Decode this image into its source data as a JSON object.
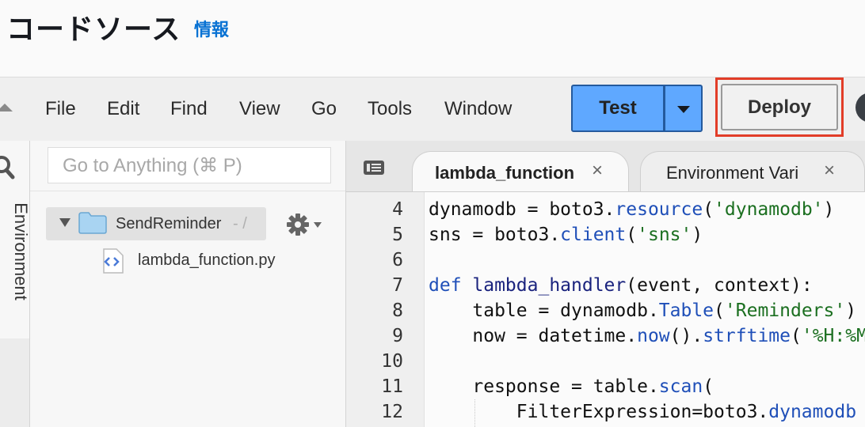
{
  "header": {
    "title": "コードソース",
    "info_link": "情報"
  },
  "menubar": {
    "items": [
      "File",
      "Edit",
      "Find",
      "View",
      "Go",
      "Tools",
      "Window"
    ],
    "test_label": "Test",
    "deploy_label": "Deploy"
  },
  "sidebar": {
    "environment_label": "Environment",
    "goto_placeholder": "Go to Anything (⌘ P)",
    "folder_name": "SendReminder",
    "folder_suffix": "- /",
    "file_name": "lambda_function.py"
  },
  "editor": {
    "tabs": [
      {
        "label": "lambda_function",
        "close": "×"
      },
      {
        "label": "Environment Vari",
        "close": "×"
      }
    ],
    "line_numbers": [
      "4",
      "5",
      "6",
      "7",
      "8",
      "9",
      "10",
      "11",
      "12"
    ],
    "lines": [
      [
        {
          "t": "dynamodb = boto3.",
          "c": ""
        },
        {
          "t": "resource",
          "c": "mt"
        },
        {
          "t": "(",
          "c": ""
        },
        {
          "t": "'dynamodb'",
          "c": "st"
        },
        {
          "t": ")",
          "c": ""
        }
      ],
      [
        {
          "t": "sns = boto3.",
          "c": ""
        },
        {
          "t": "client",
          "c": "mt"
        },
        {
          "t": "(",
          "c": ""
        },
        {
          "t": "'sns'",
          "c": "st"
        },
        {
          "t": ")",
          "c": ""
        }
      ],
      [],
      [
        {
          "t": "def ",
          "c": "kw"
        },
        {
          "t": "lambda_handler",
          "c": "fn"
        },
        {
          "t": "(event, context):",
          "c": ""
        }
      ],
      [
        {
          "t": "    table = dynamodb.",
          "c": ""
        },
        {
          "t": "Table",
          "c": "mt"
        },
        {
          "t": "(",
          "c": ""
        },
        {
          "t": "'Reminders'",
          "c": "st"
        },
        {
          "t": ")",
          "c": ""
        }
      ],
      [
        {
          "t": "    now = datetime.",
          "c": ""
        },
        {
          "t": "now",
          "c": "mt"
        },
        {
          "t": "().",
          "c": ""
        },
        {
          "t": "strftime",
          "c": "mt"
        },
        {
          "t": "(",
          "c": ""
        },
        {
          "t": "'%H:%M'",
          "c": "st"
        }
      ],
      [],
      [
        {
          "t": "    response = table.",
          "c": ""
        },
        {
          "t": "scan",
          "c": "mt"
        },
        {
          "t": "(",
          "c": ""
        }
      ],
      [
        {
          "t": "        FilterExpression=boto3.",
          "c": ""
        },
        {
          "t": "dynamodb",
          "c": "mt"
        }
      ]
    ]
  },
  "colors": {
    "test_button": "#5fa8ff",
    "deploy_highlight": "#e23d28",
    "info_link": "#0972d3"
  }
}
